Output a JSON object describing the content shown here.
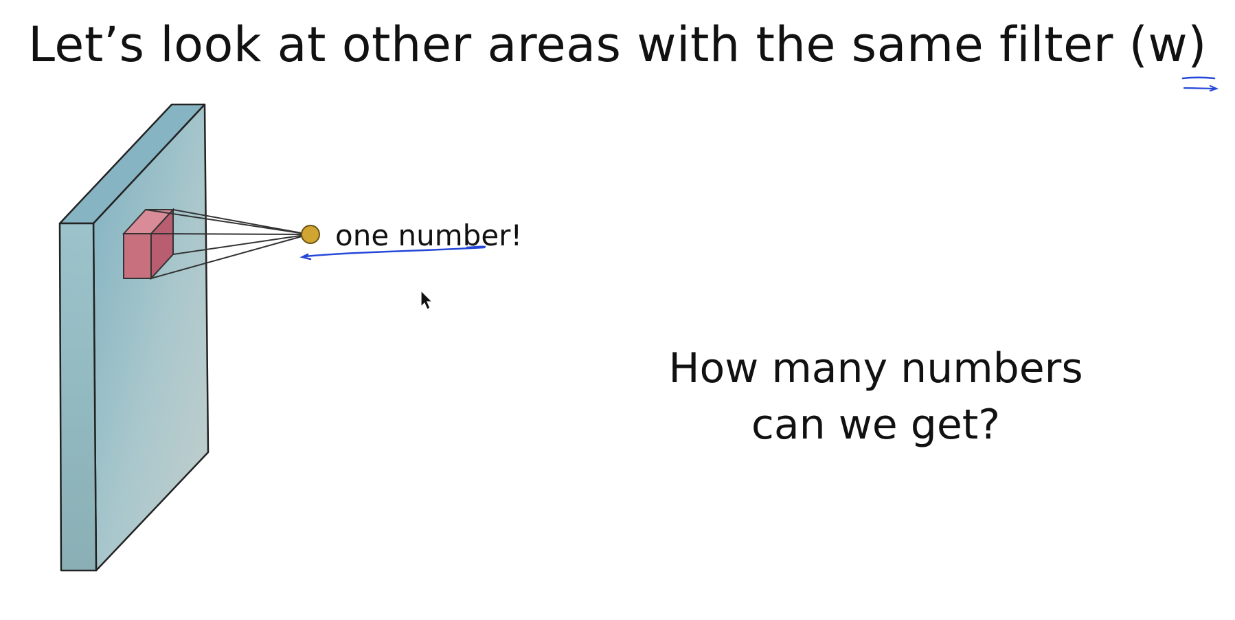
{
  "slide": {
    "title": "Let’s look at other areas with the same filter (w)",
    "output_label": "one number!",
    "question_line1": "How many numbers",
    "question_line2": "can we get?"
  },
  "colors": {
    "volume_front": "#9cbfc4",
    "volume_side": "#8fb6bd",
    "filter_front": "#c9707f",
    "filter_side": "#b85e70",
    "output_dot": "#d1a531",
    "annotation_ink": "#2547d8",
    "text": "#111111"
  },
  "icons": {
    "cursor": "mouse-pointer-icon"
  }
}
